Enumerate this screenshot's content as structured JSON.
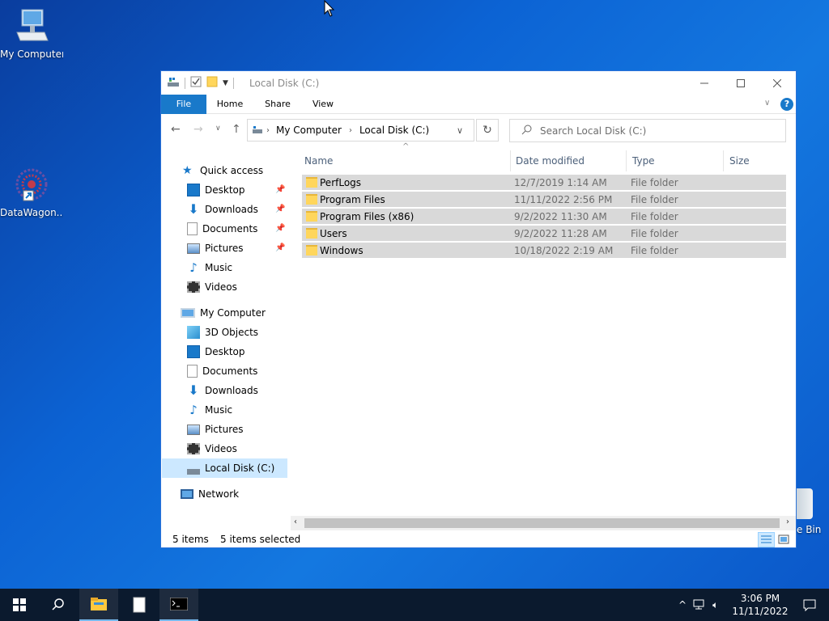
{
  "desktop": {
    "icons": [
      {
        "label": "My Computer"
      },
      {
        "label": "DataWagon..."
      }
    ],
    "recycle_bin_partial_label": "e Bin"
  },
  "window": {
    "title": "Local Disk (C:)",
    "ribbon_tabs": [
      "File",
      "Home",
      "Share",
      "View"
    ],
    "address_path": [
      "My Computer",
      "Local Disk (C:)"
    ],
    "search_placeholder": "Search Local Disk (C:)",
    "nav": {
      "quick_access": "Quick access",
      "quick_items": [
        "Desktop",
        "Downloads",
        "Documents",
        "Pictures",
        "Music",
        "Videos"
      ],
      "my_computer": "My Computer",
      "computer_items": [
        "3D Objects",
        "Desktop",
        "Documents",
        "Downloads",
        "Music",
        "Pictures",
        "Videos",
        "Local Disk (C:)"
      ],
      "network": "Network"
    },
    "columns": [
      "Name",
      "Date modified",
      "Type",
      "Size"
    ],
    "files": [
      {
        "name": "PerfLogs",
        "date": "12/7/2019 1:14 AM",
        "type": "File folder"
      },
      {
        "name": "Program Files",
        "date": "11/11/2022 2:56 PM",
        "type": "File folder"
      },
      {
        "name": "Program Files (x86)",
        "date": "9/2/2022 11:30 AM",
        "type": "File folder"
      },
      {
        "name": "Users",
        "date": "9/2/2022 11:28 AM",
        "type": "File folder"
      },
      {
        "name": "Windows",
        "date": "10/18/2022 2:19 AM",
        "type": "File folder"
      }
    ],
    "status": {
      "count": "5 items",
      "selected": "5 items selected"
    }
  },
  "taskbar": {
    "time": "3:06 PM",
    "date": "11/11/2022"
  },
  "colors": {
    "accent": "#1979ca",
    "selection": "#d9d9d9",
    "taskbar": "#0b1a2e"
  }
}
